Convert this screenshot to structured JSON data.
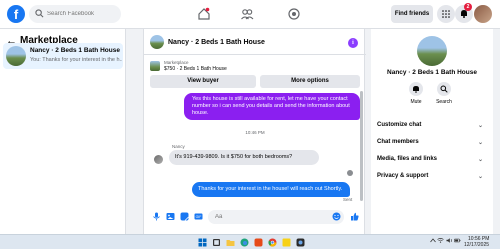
{
  "topbar": {
    "logo": "f",
    "search_placeholder": "Search Facebook",
    "find_friends_label": "Find friends",
    "notification_count": "2"
  },
  "sidebar": {
    "title": "Marketplace",
    "back_arrow": "←",
    "conversation": {
      "name": "Nancy · 2 Beds 1 Bath House",
      "preview": "You: Thanks for your interest in the h..."
    }
  },
  "chat": {
    "title": "Nancy · 2 Beds 1 Bath House",
    "listing_label": "Marketplace",
    "listing_detail": "$750 · 2 Beds 1 Bath House",
    "view_buyer_label": "View buyer",
    "more_options_label": "More options",
    "messages": [
      {
        "direction": "outgoing",
        "text": "Yes this house is still available for rent, let me have your contact number so i can send you details and send the information about house."
      },
      {
        "direction": "timestamp",
        "text": "10:46 PM"
      },
      {
        "direction": "incoming",
        "sender": "Nancy",
        "text": "It's 919-439-9809. Is it $750 for both bedrooms?"
      },
      {
        "direction": "outgoing",
        "text": "Thanks for your interest in the house! will reach out Shortly."
      }
    ],
    "sent_label": "Sent",
    "composer_placeholder": "Aa"
  },
  "details": {
    "title": "Nancy · 2 Beds 1 Bath House",
    "mute_label": "Mute",
    "search_label": "Search",
    "rows": [
      "Customize chat",
      "Chat members",
      "Media, files and links",
      "Privacy & support"
    ]
  },
  "taskbar": {
    "time": "10:56 PM",
    "date": "12/17/2025"
  },
  "colors": {
    "brand": "#1877f2",
    "outgoing_purple": "#8b1ff0",
    "outgoing_blue": "#1877f2",
    "incoming_gray": "#e4e6eb"
  }
}
